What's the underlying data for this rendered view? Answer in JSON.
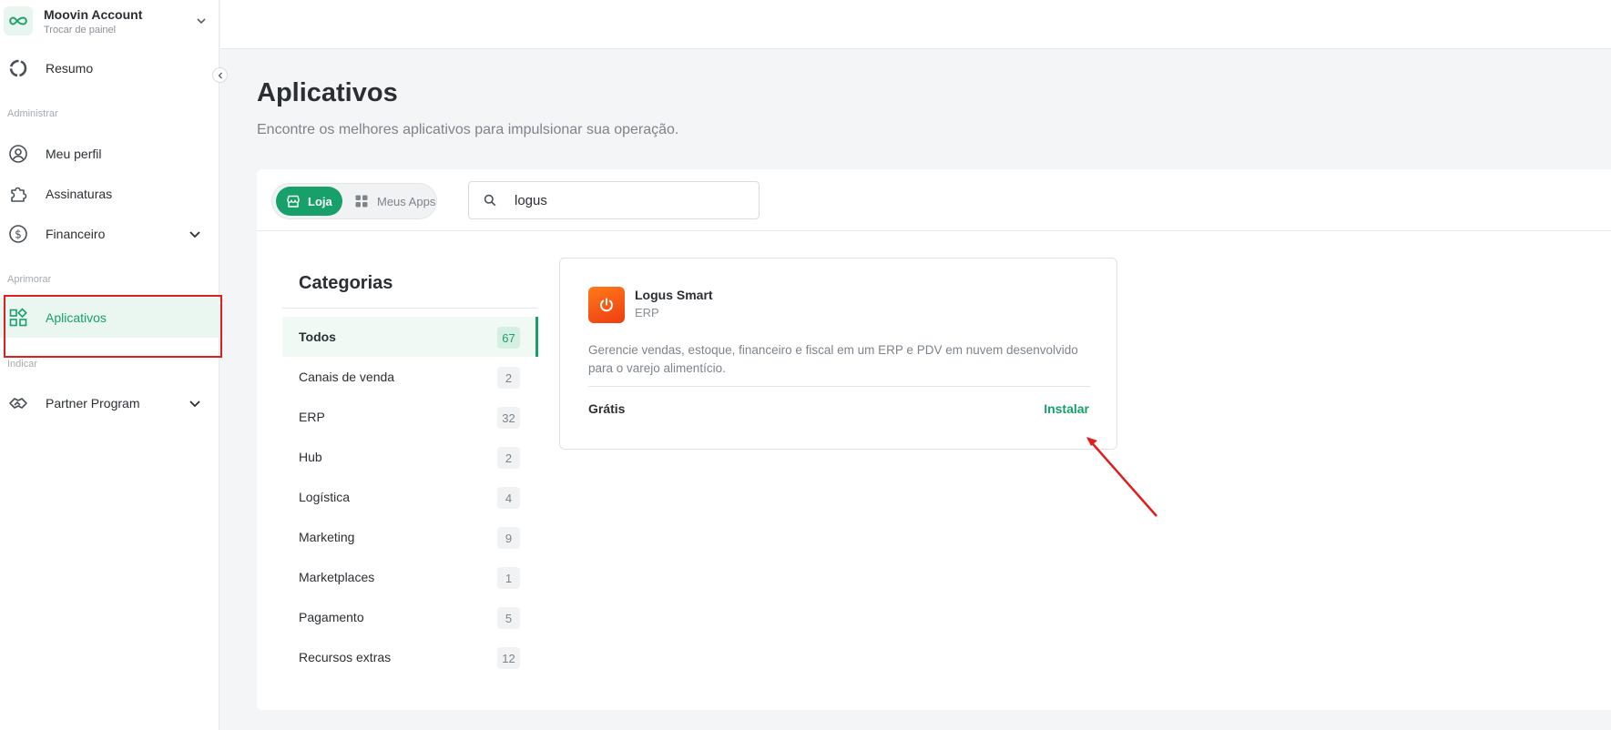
{
  "sidebar": {
    "account": {
      "name": "Moovin Account",
      "subtitle": "Trocar de painel"
    },
    "items": [
      {
        "label": "Resumo"
      },
      {
        "label": "Meu perfil"
      },
      {
        "label": "Assinaturas"
      },
      {
        "label": "Financeiro"
      },
      {
        "label": "Aplicativos"
      },
      {
        "label": "Partner Program"
      }
    ],
    "sections": {
      "administrar": "Administrar",
      "aprimorar": "Aprimorar",
      "indicar": "Indicar"
    }
  },
  "page": {
    "title": "Aplicativos",
    "subtitle": "Encontre os melhores aplicativos para impulsionar sua operação."
  },
  "toolbar": {
    "tab_loja": "Loja",
    "tab_meus": "Meus Apps",
    "search_value": "logus"
  },
  "categories": {
    "title": "Categorias",
    "items": [
      {
        "label": "Todos",
        "count": "67"
      },
      {
        "label": "Canais de venda",
        "count": "2"
      },
      {
        "label": "ERP",
        "count": "32"
      },
      {
        "label": "Hub",
        "count": "2"
      },
      {
        "label": "Logística",
        "count": "4"
      },
      {
        "label": "Marketing",
        "count": "9"
      },
      {
        "label": "Marketplaces",
        "count": "1"
      },
      {
        "label": "Pagamento",
        "count": "5"
      },
      {
        "label": "Recursos extras",
        "count": "12"
      }
    ]
  },
  "app_card": {
    "name": "Logus Smart",
    "category": "ERP",
    "description": "Gerencie vendas, estoque, financeiro e fiscal em um ERP e PDV em nuvem desenvolvido para o varejo alimentício.",
    "price": "Grátis",
    "install_label": "Instalar"
  },
  "colors": {
    "accent": "#17a06a",
    "highlight": "#e01e1e",
    "app_logo": "#f05a16"
  },
  "icons": {
    "account": "infinity-icon",
    "resumo": "donut-icon",
    "perfil": "user-circle-icon",
    "assinaturas": "puzzle-icon",
    "financeiro": "dollar-circle-icon",
    "aplicativos": "apps-grid-icon",
    "partner": "handshake-icon",
    "search": "search-icon",
    "app": "power-icon"
  }
}
